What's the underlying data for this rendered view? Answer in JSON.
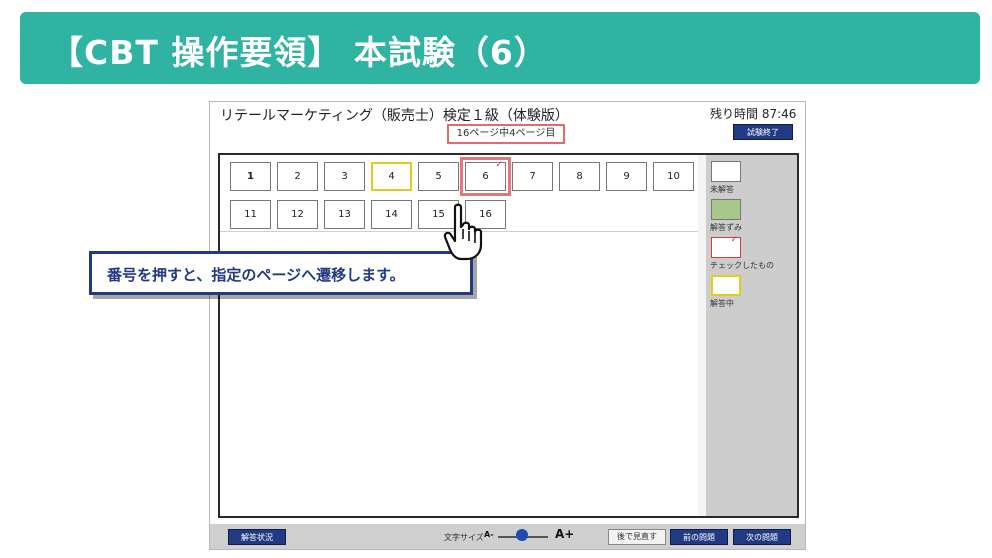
{
  "banner": {
    "title": "【CBT 操作要領】 本試験（6）"
  },
  "exam": {
    "title": "リテールマーケティング（販売士）検定１級（体験版）",
    "page_indicator": "16ページ中4ページ目",
    "time_left": "残り時間 87:46",
    "end_button": "試験終了"
  },
  "questions": [
    {
      "label": "1",
      "state": "unanswered"
    },
    {
      "label": "2",
      "state": "unanswered"
    },
    {
      "label": "3",
      "state": "unanswered"
    },
    {
      "label": "4",
      "state": "current"
    },
    {
      "label": "5",
      "state": "unanswered"
    },
    {
      "label": "6",
      "state": "checked"
    },
    {
      "label": "7",
      "state": "unanswered"
    },
    {
      "label": "8",
      "state": "unanswered"
    },
    {
      "label": "9",
      "state": "unanswered"
    },
    {
      "label": "10",
      "state": "unanswered"
    },
    {
      "label": "11",
      "state": "unanswered"
    },
    {
      "label": "12",
      "state": "unanswered"
    },
    {
      "label": "13",
      "state": "unanswered"
    },
    {
      "label": "14",
      "state": "unanswered"
    },
    {
      "label": "15",
      "state": "unanswered"
    },
    {
      "label": "16",
      "state": "unanswered"
    }
  ],
  "legend": {
    "unanswered": "未解答",
    "answered": "解答ずみ",
    "checked": "チェックしたもの",
    "current": "解答中"
  },
  "callout": {
    "text": "番号を押すと、指定のページへ遷移します。"
  },
  "bottom": {
    "status_button": "解答状況",
    "font_size_label": "文字サイズ",
    "font_minus": "A-",
    "font_plus": "A+",
    "review_button": "後で見直す",
    "prev_button": "前の問題",
    "next_button": "次の問題"
  },
  "colors": {
    "banner": "#2fb3a3",
    "nav_button": "#223a84",
    "answered": "#a7c98b",
    "current_border": "#e0cf1a",
    "check": "#d63a3a"
  },
  "icons": {
    "pointer": "hand-pointer-icon",
    "check": "check-mark-icon"
  }
}
